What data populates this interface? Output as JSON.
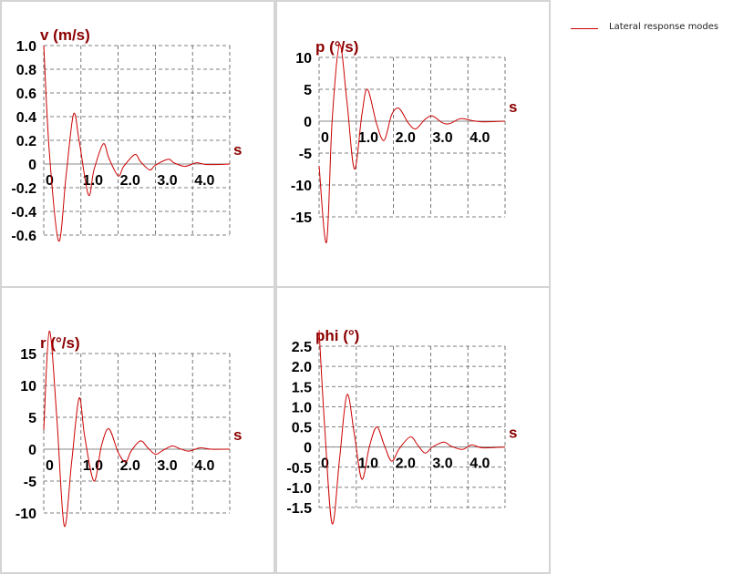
{
  "legend": {
    "label": "Lateral response modes",
    "color": "#cc0000"
  },
  "colors": {
    "curve": "#cc0000",
    "title": "#8b0000",
    "grid": "#555555",
    "tick": "#000000"
  },
  "chart_data": [
    {
      "type": "line",
      "title": "v (m/s)",
      "xlabel": "s",
      "x_ticks": [
        "0",
        "1.0",
        "2.0",
        "3.0",
        "4.0"
      ],
      "y_ticks": [
        "1.0",
        "0.8",
        "0.6",
        "0.4",
        "0.2",
        "0",
        "-0.2",
        "-0.4",
        "-0.6"
      ],
      "xlim": [
        0,
        5
      ],
      "ylim": [
        -0.6,
        1.0
      ],
      "series": [
        {
          "x": [
            0,
            0.15,
            0.4,
            0.6,
            0.8,
            0.95,
            1.2,
            1.35,
            1.6,
            1.75,
            2.0,
            2.15,
            2.45,
            2.6,
            2.85,
            3.0,
            3.35,
            3.5,
            3.8,
            4.1,
            4.4,
            5.0
          ],
          "values": [
            1.0,
            0.1,
            -0.65,
            -0.1,
            0.42,
            0.2,
            -0.26,
            -0.05,
            0.17,
            0.05,
            -0.1,
            -0.02,
            0.08,
            0.02,
            -0.05,
            -0.01,
            0.04,
            0.01,
            -0.02,
            0.01,
            -0.005,
            0.0
          ]
        }
      ]
    },
    {
      "type": "line",
      "title": "p (°/s)",
      "xlabel": "s",
      "x_ticks": [
        "0",
        "1.0",
        "2.0",
        "3.0",
        "4.0"
      ],
      "y_ticks": [
        "10",
        "5",
        "0",
        "-5",
        "-10",
        "-15"
      ],
      "xlim": [
        0,
        5
      ],
      "ylim": [
        -15,
        10
      ],
      "series": [
        {
          "x": [
            0,
            0.2,
            0.35,
            0.55,
            0.75,
            0.95,
            1.15,
            1.3,
            1.55,
            1.75,
            1.95,
            2.15,
            2.4,
            2.6,
            2.85,
            3.05,
            3.3,
            3.5,
            3.8,
            4.1,
            4.4,
            5.0
          ],
          "values": [
            -7,
            -19,
            0,
            12,
            3,
            -7.5,
            1,
            5,
            -0.5,
            -3,
            1,
            2,
            -0.3,
            -1.2,
            0.3,
            0.8,
            -0.2,
            -0.4,
            0.4,
            0.1,
            -0.1,
            0.0
          ]
        }
      ]
    },
    {
      "type": "line",
      "title": "r (°/s)",
      "xlabel": "s",
      "x_ticks": [
        "0",
        "1.0",
        "2.0",
        "3.0",
        "4.0"
      ],
      "y_ticks": [
        "15",
        "10",
        "5",
        "0",
        "-5",
        "-10"
      ],
      "xlim": [
        0,
        5
      ],
      "ylim": [
        -10,
        15
      ],
      "series": [
        {
          "x": [
            0,
            0.15,
            0.35,
            0.55,
            0.75,
            0.95,
            1.1,
            1.35,
            1.55,
            1.75,
            2.0,
            2.2,
            2.35,
            2.6,
            2.8,
            3.0,
            3.2,
            3.45,
            3.65,
            3.9,
            4.2,
            4.5,
            5.0
          ],
          "values": [
            3,
            18.5,
            5,
            -12,
            -2,
            8,
            2,
            -5,
            0.5,
            3.2,
            -0.5,
            -2,
            -0.3,
            1.3,
            0.2,
            -0.8,
            -0.2,
            0.5,
            0.1,
            -0.3,
            0.2,
            0.0,
            0.0
          ]
        }
      ]
    },
    {
      "type": "line",
      "title": "phi (°)",
      "xlabel": "s",
      "x_ticks": [
        "0",
        "1.0",
        "2.0",
        "3.0",
        "4.0"
      ],
      "y_ticks": [
        "2.5",
        "2.0",
        "1.5",
        "1.0",
        "0.5",
        "0",
        "-0.5",
        "-1.0",
        "-1.5"
      ],
      "xlim": [
        0,
        5
      ],
      "ylim": [
        -1.5,
        2.5
      ],
      "series": [
        {
          "x": [
            0,
            0.15,
            0.35,
            0.55,
            0.75,
            0.95,
            1.15,
            1.35,
            1.55,
            1.75,
            1.95,
            2.15,
            2.45,
            2.65,
            2.85,
            3.05,
            3.35,
            3.55,
            3.85,
            4.1,
            4.4,
            5.0
          ],
          "values": [
            2.9,
            0.5,
            -1.9,
            -0.3,
            1.3,
            0.3,
            -0.8,
            0.0,
            0.5,
            0.05,
            -0.35,
            -0.05,
            0.25,
            0.05,
            -0.15,
            0.0,
            0.12,
            0.02,
            -0.06,
            0.05,
            -0.02,
            0.0
          ]
        }
      ]
    }
  ]
}
